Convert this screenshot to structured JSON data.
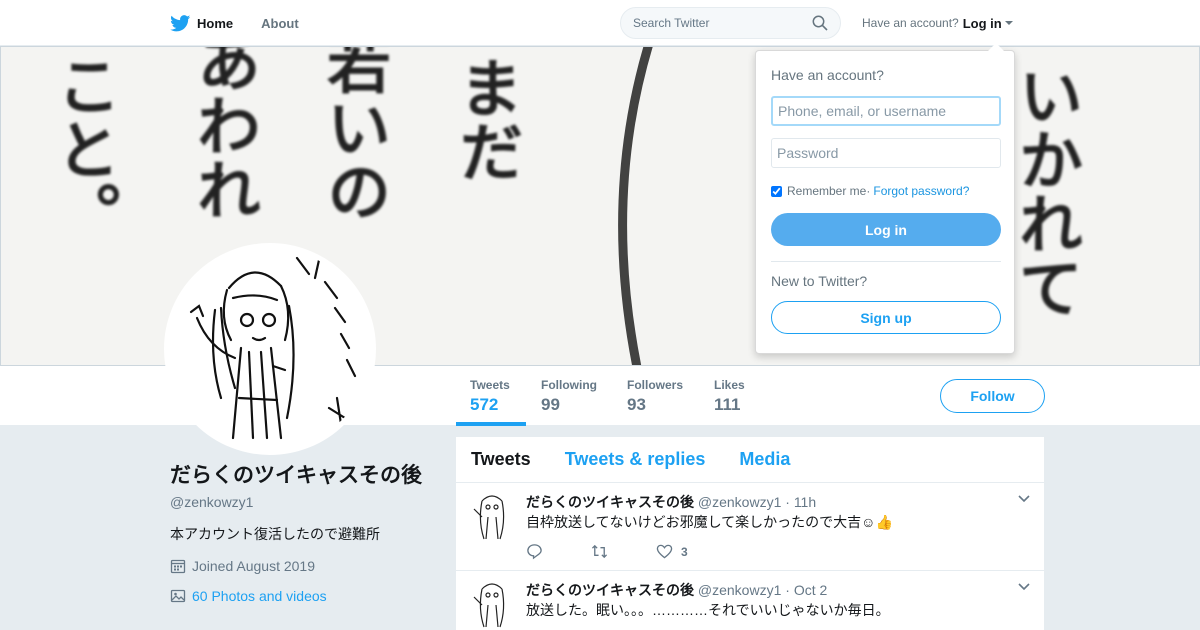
{
  "nav": {
    "home_label": "Home",
    "about_label": "About",
    "search_placeholder": "Search Twitter",
    "have_account": "Have an account?",
    "login_label": "Log in",
    "brand_color": "#1da1f2"
  },
  "banner": {
    "columns": [
      "こと。",
      "あわれ",
      "若いの",
      "まだ",
      "いかれて"
    ]
  },
  "profile": {
    "name": "だらくのツイキャスその後",
    "handle": "@zenkowzy1",
    "bio": "本アカウント復活したので避難所",
    "joined": "Joined August 2019",
    "photos": "60 Photos and videos"
  },
  "stats": [
    {
      "label": "Tweets",
      "value": "572"
    },
    {
      "label": "Following",
      "value": "99"
    },
    {
      "label": "Followers",
      "value": "93"
    },
    {
      "label": "Likes",
      "value": "111"
    }
  ],
  "follow_label": "Follow",
  "timeline": {
    "tabs": [
      "Tweets",
      "Tweets & replies",
      "Media"
    ],
    "tweets": [
      {
        "name": "だらくのツイキャスその後",
        "handle": "@zenkowzy1",
        "sep": " · ",
        "time": "11h",
        "text": "自枠放送してないけどお邪魔して楽しかったので大吉☺👍",
        "likes": "3"
      },
      {
        "name": "だらくのツイキャスその後",
        "handle": "@zenkowzy1",
        "sep": " · ",
        "time": "Oct 2",
        "text": "放送した。眠い。。。…………それでいいじゃないか毎日。",
        "likes": ""
      }
    ]
  },
  "login_dropdown": {
    "title": "Have an account?",
    "username_placeholder": "Phone, email, or username",
    "password_placeholder": "Password",
    "remember_label": "Remember me",
    "separator": " · ",
    "forgot_label": "Forgot password?",
    "login_button": "Log in",
    "new_label": "New to Twitter?",
    "signup_button": "Sign up"
  }
}
